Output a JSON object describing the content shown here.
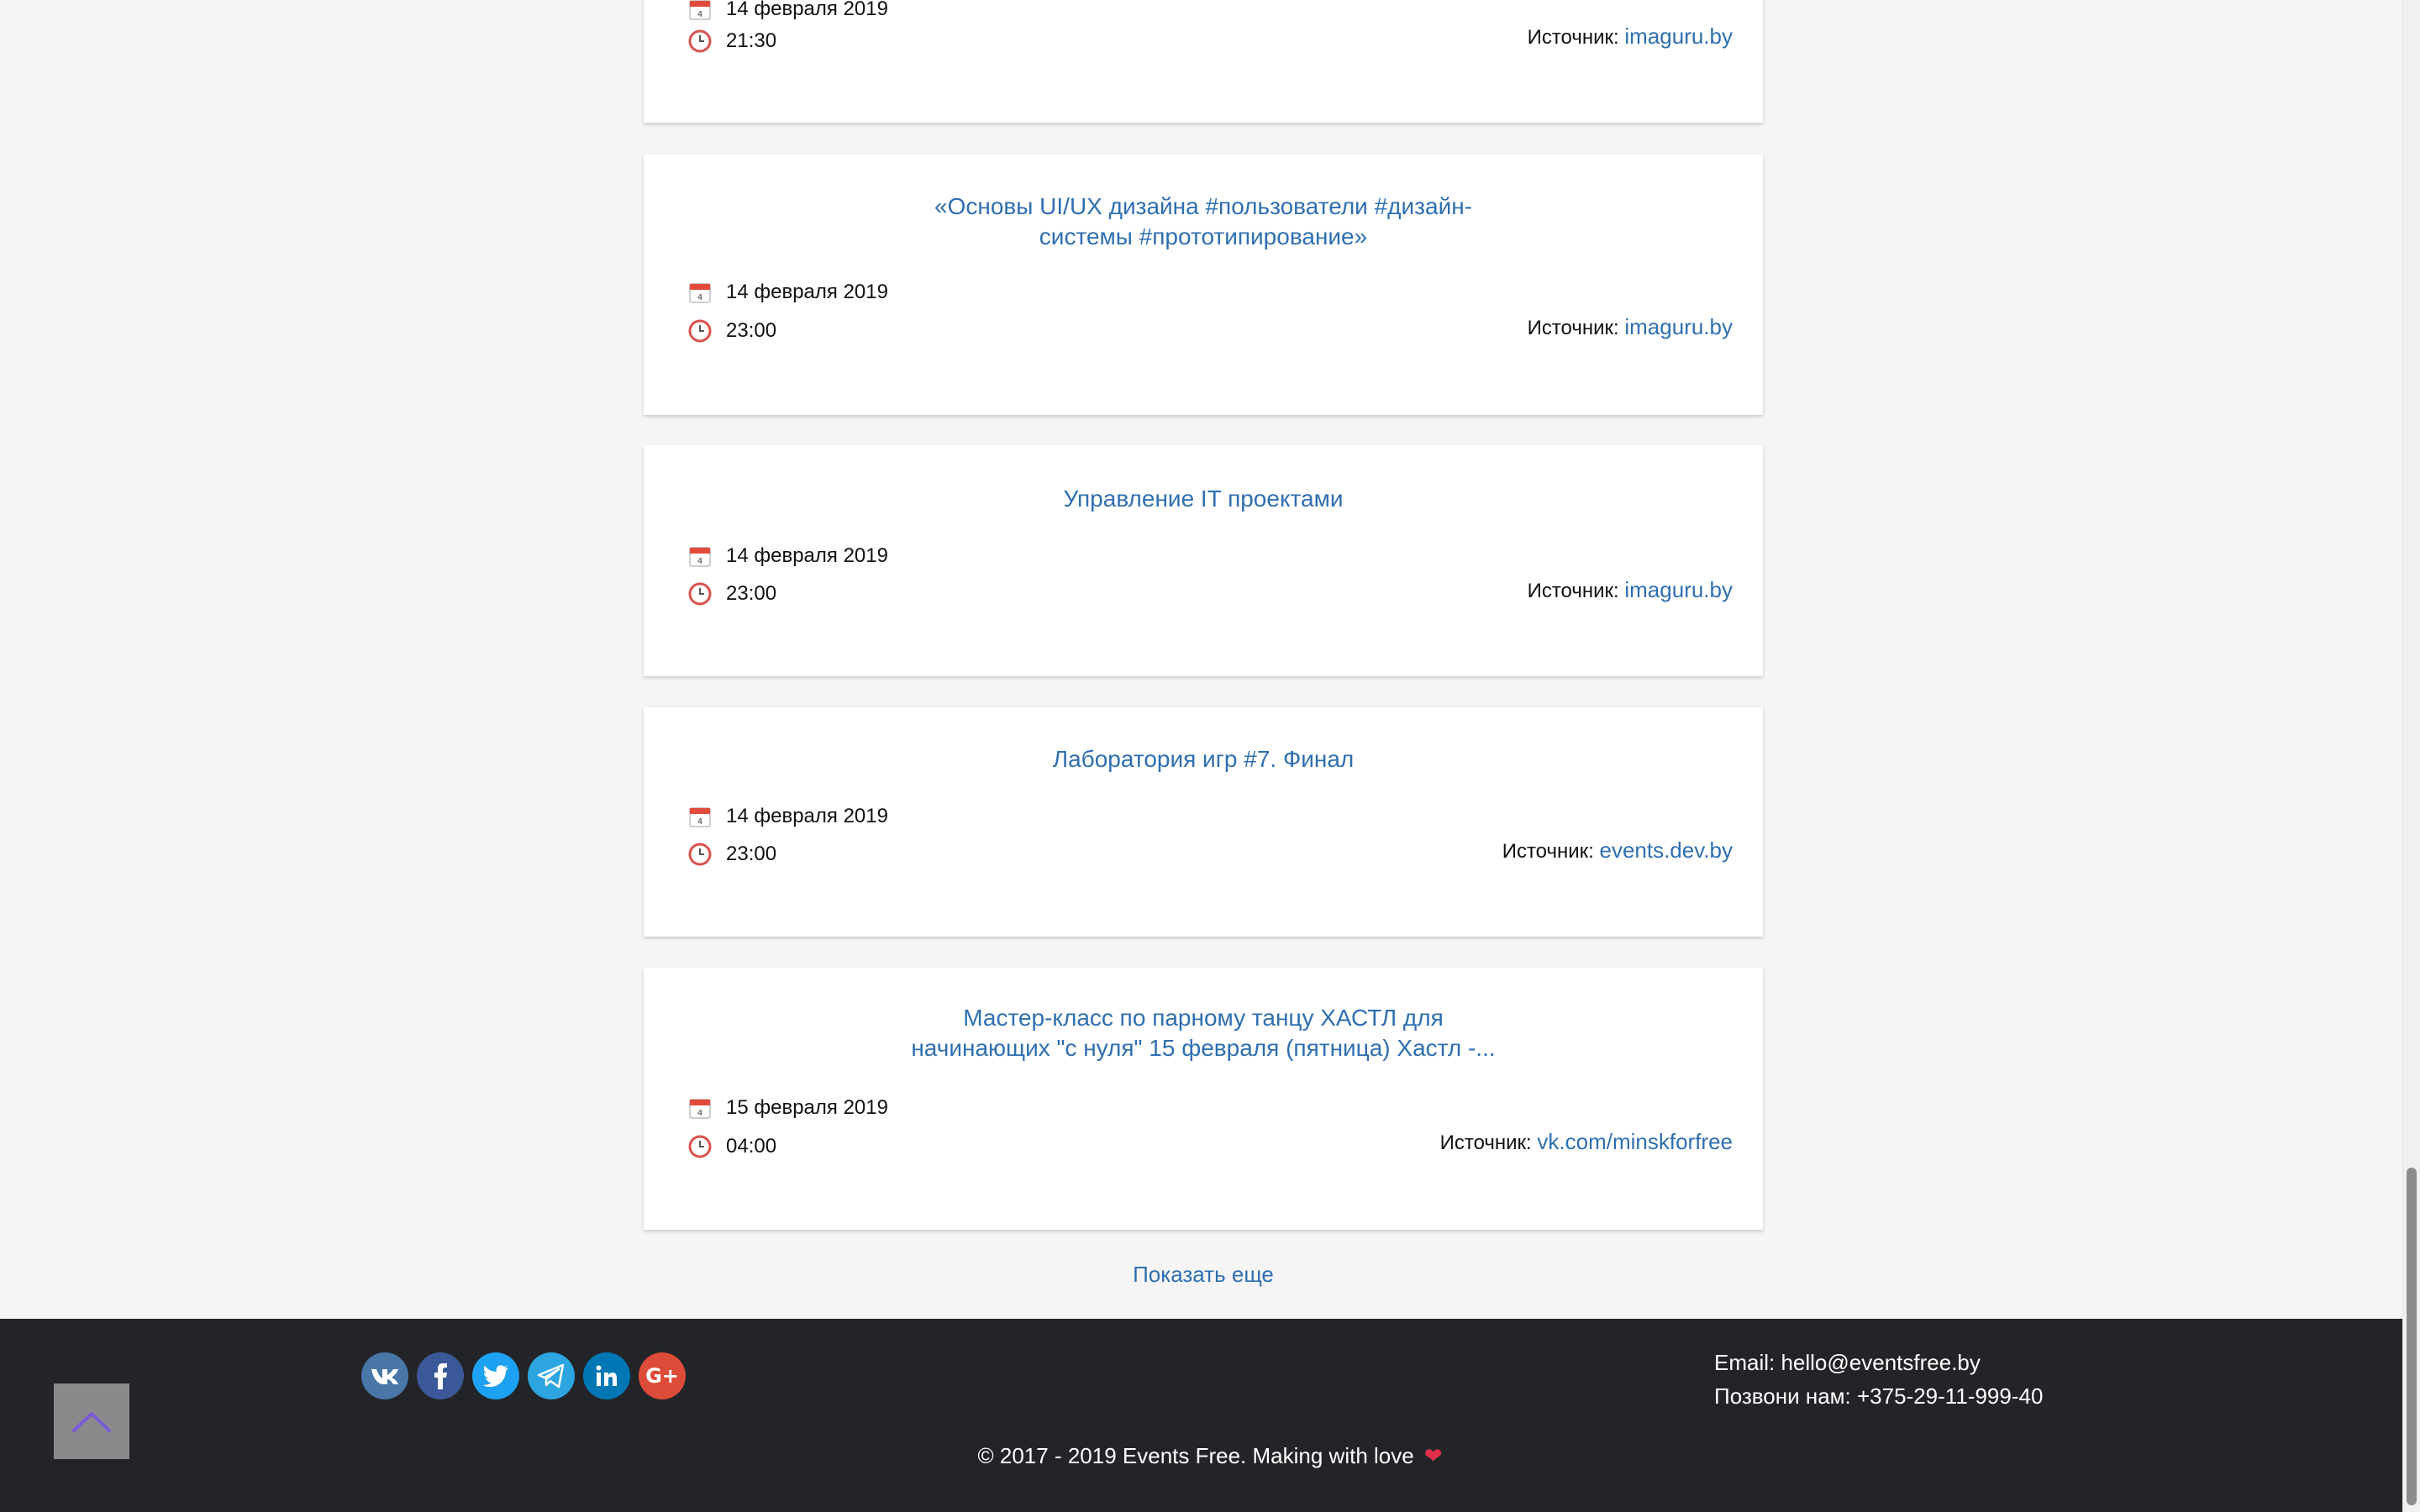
{
  "events": [
    {
      "title": "",
      "date": "14 февраля 2019",
      "time": "21:30",
      "source_label": "Источник:",
      "source_link": "imaguru.by"
    },
    {
      "title": "«Основы UI/UX дизайна #пользователи #дизайн-системы #прототипирование»",
      "date": "14 февраля 2019",
      "time": "23:00",
      "source_label": "Источник:",
      "source_link": "imaguru.by"
    },
    {
      "title": "Управление IT проектами",
      "date": "14 февраля 2019",
      "time": "23:00",
      "source_label": "Источник:",
      "source_link": "imaguru.by"
    },
    {
      "title": "Лаборатория игр #7. Финал",
      "date": "14 февраля 2019",
      "time": "23:00",
      "source_label": "Источник:",
      "source_link": "events.dev.by"
    },
    {
      "title": "Мастер-класс по парному танцу ХАСТЛ для начинающих \"с нуля\" 15 февраля (пятница) Хастл -...",
      "date": "15 февраля 2019",
      "time": "04:00",
      "source_label": "Источник:",
      "source_link": "vk.com/minskforfree"
    }
  ],
  "show_more": "Показать еще",
  "footer": {
    "social": [
      {
        "name": "vk",
        "label": "VK",
        "color": "#4a76a8"
      },
      {
        "name": "facebook",
        "label": "f",
        "color": "#3b5998"
      },
      {
        "name": "twitter",
        "label": "t",
        "color": "#1da1f2"
      },
      {
        "name": "telegram",
        "label": "tg",
        "color": "#2ca5e0"
      },
      {
        "name": "linkedin",
        "label": "in",
        "color": "#0077b5"
      },
      {
        "name": "google-plus",
        "label": "G+",
        "color": "#dd4b39"
      }
    ],
    "email": "Email: hello@eventsfree.by",
    "phone": "Позвони нам: +375-29-11-999-40",
    "copyright": "© 2017 - 2019 Events Free. Making with love",
    "heart": "❤"
  },
  "icons": {
    "calendar": "calendar-icon",
    "clock": "clock-icon",
    "back_to_top": "chevron-up-icon"
  },
  "colors": {
    "link": "#2f6fb0",
    "footer_bg": "#232428",
    "page_bg": "#f5f5f5",
    "icon_red": "#d9534f"
  }
}
